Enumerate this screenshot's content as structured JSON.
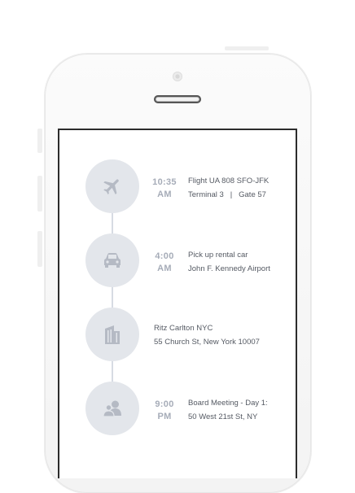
{
  "events": [
    {
      "time": "10:35",
      "ampm": "AM",
      "line1": "Flight UA 808 SFO-JFK",
      "line2": "Terminal 3   |   Gate 57",
      "icon": "airplane-icon"
    },
    {
      "time": "4:00",
      "ampm": "AM",
      "line1": "Pick up rental car",
      "line2": "John F. Kennedy Airport",
      "icon": "car-icon"
    },
    {
      "time": "",
      "ampm": "",
      "line1": "Ritz Carlton NYC",
      "line2": "55 Church St, New York 10007",
      "icon": "building-icon"
    },
    {
      "time": "9:00",
      "ampm": "PM",
      "line1": "Board Meeting - Day 1:",
      "line2": "50 West 21st St, NY",
      "icon": "meeting-people-icon"
    }
  ],
  "colors": {
    "circle": "#e3e6eb",
    "icon": "#b5bac4",
    "time": "#a6acb8",
    "text": "#555a63"
  }
}
